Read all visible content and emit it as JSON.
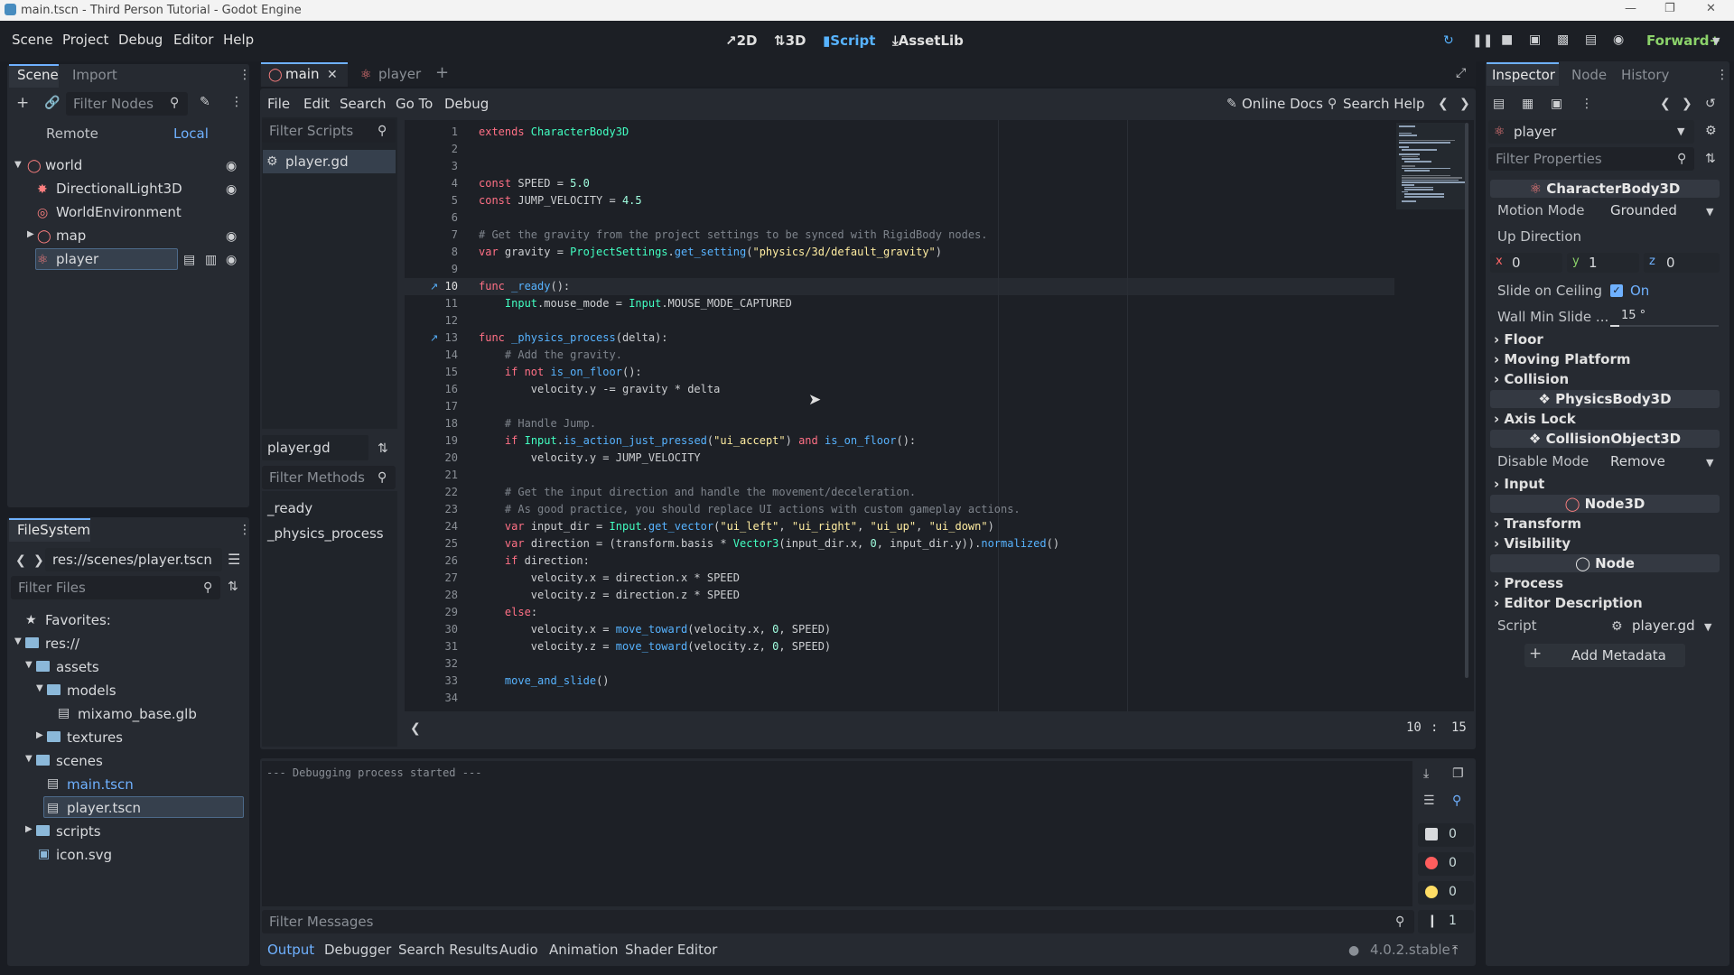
{
  "window": {
    "title": "main.tscn - Third Person Tutorial - Godot Engine"
  },
  "menu": {
    "items": [
      "Scene",
      "Project",
      "Debug",
      "Editor",
      "Help"
    ]
  },
  "workspaces": {
    "2d": "2D",
    "3d": "3D",
    "script": "Script",
    "assetlib": "AssetLib",
    "renderer": "Forward+"
  },
  "scene_dock": {
    "tab_scene": "Scene",
    "tab_import": "Import",
    "filter_placeholder": "Filter Nodes",
    "remote": "Remote",
    "local": "Local",
    "nodes": [
      "world",
      "DirectionalLight3D",
      "WorldEnvironment",
      "map",
      "player"
    ]
  },
  "filesystem": {
    "tab": "FileSystem",
    "path": "res://scenes/player.tscn",
    "filter_placeholder": "Filter Files",
    "items": [
      "Favorites:",
      "res://",
      "assets",
      "models",
      "mixamo_base.glb",
      "textures",
      "scenes",
      "main.tscn",
      "player.tscn",
      "scripts",
      "icon.svg"
    ]
  },
  "editor_tabs": {
    "main": "main",
    "player": "player"
  },
  "script_menu": {
    "items": [
      "File",
      "Edit",
      "Search",
      "Go To",
      "Debug"
    ],
    "online_docs": "Online Docs",
    "search_help": "Search Help"
  },
  "scripts_panel": {
    "filter_placeholder": "Filter Scripts",
    "item": "player.gd",
    "current": "player.gd",
    "methods_placeholder": "Filter Methods",
    "methods": [
      "_ready",
      "_physics_process"
    ]
  },
  "code": {
    "lines": [
      [
        [
          "kw",
          "extends "
        ],
        [
          "cls",
          "CharacterBody3D"
        ]
      ],
      [],
      [],
      [
        [
          "kw",
          "const "
        ],
        [
          "nm",
          "SPEED = "
        ],
        [
          "nu",
          "5.0"
        ]
      ],
      [
        [
          "kw",
          "const "
        ],
        [
          "nm",
          "JUMP_VELOCITY = "
        ],
        [
          "nu",
          "4.5"
        ]
      ],
      [],
      [
        [
          "cm",
          "# Get the gravity from the project settings to be synced with RigidBody nodes."
        ]
      ],
      [
        [
          "kw",
          "var "
        ],
        [
          "nm",
          "gravity = "
        ],
        [
          "cls",
          "ProjectSettings"
        ],
        [
          "nm",
          "."
        ],
        [
          "fn",
          "get_setting"
        ],
        [
          "nm",
          "("
        ],
        [
          "st",
          "\"physics/3d/default_gravity\""
        ],
        [
          "nm",
          ")"
        ]
      ],
      [],
      [
        [
          "kw",
          "func "
        ],
        [
          "fn",
          "_ready"
        ],
        [
          "nm",
          "():"
        ]
      ],
      [
        [
          "nm",
          "    "
        ],
        [
          "cls",
          "Input"
        ],
        [
          "nm",
          ".mouse_mode = "
        ],
        [
          "cls",
          "Input"
        ],
        [
          "nm",
          ".MOUSE_MODE_CAPTURED"
        ]
      ],
      [],
      [
        [
          "kw",
          "func "
        ],
        [
          "fn",
          "_physics_process"
        ],
        [
          "nm",
          "(delta):"
        ]
      ],
      [
        [
          "nm",
          "    "
        ],
        [
          "cm",
          "# Add the gravity."
        ]
      ],
      [
        [
          "nm",
          "    "
        ],
        [
          "kw",
          "if not "
        ],
        [
          "fn",
          "is_on_floor"
        ],
        [
          "nm",
          "():"
        ]
      ],
      [
        [
          "nm",
          "        velocity.y -= gravity * delta"
        ]
      ],
      [],
      [
        [
          "nm",
          "    "
        ],
        [
          "cm",
          "# Handle Jump."
        ]
      ],
      [
        [
          "nm",
          "    "
        ],
        [
          "kw",
          "if "
        ],
        [
          "cls",
          "Input"
        ],
        [
          "nm",
          "."
        ],
        [
          "fn",
          "is_action_just_pressed"
        ],
        [
          "nm",
          "("
        ],
        [
          "st",
          "\"ui_accept\""
        ],
        [
          "nm",
          ") "
        ],
        [
          "kw",
          "and "
        ],
        [
          "fn",
          "is_on_floor"
        ],
        [
          "nm",
          "():"
        ]
      ],
      [
        [
          "nm",
          "        velocity.y = JUMP_VELOCITY"
        ]
      ],
      [],
      [
        [
          "nm",
          "    "
        ],
        [
          "cm",
          "# Get the input direction and handle the movement/deceleration."
        ]
      ],
      [
        [
          "nm",
          "    "
        ],
        [
          "cm",
          "# As good practice, you should replace UI actions with custom gameplay actions."
        ]
      ],
      [
        [
          "nm",
          "    "
        ],
        [
          "kw",
          "var "
        ],
        [
          "nm",
          "input_dir = "
        ],
        [
          "cls",
          "Input"
        ],
        [
          "nm",
          "."
        ],
        [
          "fn",
          "get_vector"
        ],
        [
          "nm",
          "("
        ],
        [
          "st",
          "\"ui_left\""
        ],
        [
          "nm",
          ", "
        ],
        [
          "st",
          "\"ui_right\""
        ],
        [
          "nm",
          ", "
        ],
        [
          "st",
          "\"ui_up\""
        ],
        [
          "nm",
          ", "
        ],
        [
          "st",
          "\"ui_down\""
        ],
        [
          "nm",
          ")"
        ]
      ],
      [
        [
          "nm",
          "    "
        ],
        [
          "kw",
          "var "
        ],
        [
          "nm",
          "direction = (transform.basis * "
        ],
        [
          "cls",
          "Vector3"
        ],
        [
          "nm",
          "(input_dir.x, "
        ],
        [
          "nu",
          "0"
        ],
        [
          "nm",
          ", input_dir.y))."
        ],
        [
          "fn",
          "normalized"
        ],
        [
          "nm",
          "()"
        ]
      ],
      [
        [
          "nm",
          "    "
        ],
        [
          "kw",
          "if "
        ],
        [
          "nm",
          "direction:"
        ]
      ],
      [
        [
          "nm",
          "        velocity.x = direction.x * SPEED"
        ]
      ],
      [
        [
          "nm",
          "        velocity.z = direction.z * SPEED"
        ]
      ],
      [
        [
          "nm",
          "    "
        ],
        [
          "kw",
          "else"
        ],
        [
          "nm",
          ":"
        ]
      ],
      [
        [
          "nm",
          "        velocity.x = "
        ],
        [
          "fn",
          "move_toward"
        ],
        [
          "nm",
          "(velocity.x, "
        ],
        [
          "nu",
          "0"
        ],
        [
          "nm",
          ", SPEED)"
        ]
      ],
      [
        [
          "nm",
          "        velocity.z = "
        ],
        [
          "fn",
          "move_toward"
        ],
        [
          "nm",
          "(velocity.z, "
        ],
        [
          "nu",
          "0"
        ],
        [
          "nm",
          ", SPEED)"
        ]
      ],
      [],
      [
        [
          "nm",
          "    "
        ],
        [
          "fn",
          "move_and_slide"
        ],
        [
          "nm",
          "()"
        ]
      ],
      []
    ]
  },
  "cursor": {
    "line": "10",
    "col": "15"
  },
  "output": {
    "message": "--- Debugging process started ---",
    "filter_placeholder": "Filter Messages",
    "counts": [
      "0",
      "0",
      "0",
      "1"
    ],
    "tabs": [
      "Output",
      "Debugger",
      "Search Results",
      "Audio",
      "Animation",
      "Shader Editor"
    ],
    "version": "4.0.2.stable"
  },
  "inspector": {
    "tabs": [
      "Inspector",
      "Node",
      "History"
    ],
    "object": "player",
    "filter_placeholder": "Filter Properties",
    "class_header": "CharacterBody3D",
    "motion_mode_label": "Motion Mode",
    "motion_mode_value": "Grounded",
    "up_direction_label": "Up Direction",
    "up_x": "0",
    "up_y": "1",
    "up_z": "0",
    "slide_label": "Slide on Ceiling",
    "slide_value": "On",
    "wall_label": "Wall Min Slide ...",
    "wall_value": "15 °",
    "floor": "Floor",
    "moving_platform": "Moving Platform",
    "collision": "Collision",
    "physicsbody": "PhysicsBody3D",
    "axis_lock": "Axis Lock",
    "collisionobject": "CollisionObject3D",
    "disable_mode_label": "Disable Mode",
    "disable_mode_value": "Remove",
    "input": "Input",
    "node3d": "Node3D",
    "transform": "Transform",
    "visibility": "Visibility",
    "node": "Node",
    "process": "Process",
    "editor_description": "Editor Description",
    "script_label": "Script",
    "script_value": "player.gd",
    "add_metadata": "Add Metadata"
  }
}
